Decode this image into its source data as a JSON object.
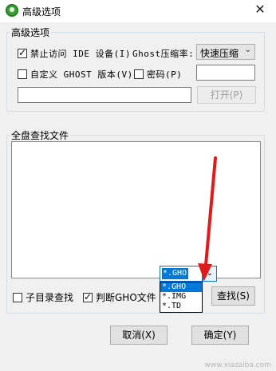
{
  "window": {
    "title": "高级选项",
    "close_glyph": "✕"
  },
  "advanced": {
    "group_title": "高级选项",
    "disable_ide_label": "禁止访问 IDE 设备(I)",
    "disable_ide_checked": true,
    "ghost_compress_label": "Ghost压缩率:",
    "compress_value": "快速压缩",
    "custom_ghost_label": "自定义 GHOST 版本(V)",
    "custom_ghost_checked": false,
    "password_label": "密码(P)",
    "password_checked": false,
    "password_value": "",
    "path_value": "",
    "open_button": "打开(P)"
  },
  "search": {
    "group_title": "全盘查找文件",
    "subdir_label": "子目录查找",
    "subdir_checked": false,
    "judge_gho_label": "判断GHO文件",
    "judge_gho_checked": true,
    "ext_value": "*.GHO",
    "ext_options": [
      "*.GHO",
      "*.IMG",
      "*.TD"
    ],
    "find_button": "查找(S)"
  },
  "footer": {
    "cancel_button": "取消(X)",
    "ok_button": "确定(Y)"
  },
  "watermark": "www.xiazaiba.com",
  "colors": {
    "accent": "#0078d7",
    "arrow": "#e01b1b",
    "icon": "#3aa335"
  }
}
